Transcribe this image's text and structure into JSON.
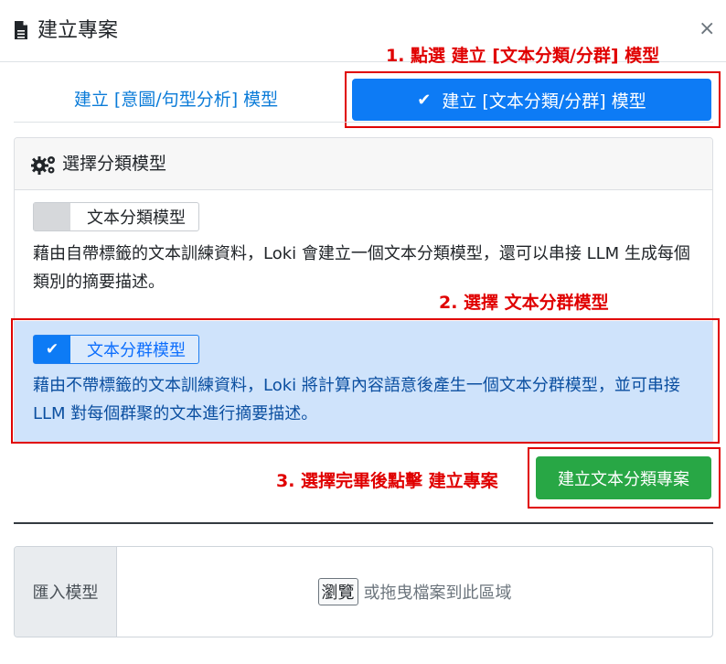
{
  "modal": {
    "title": "建立專案",
    "close": "×"
  },
  "tabs": {
    "intent": "建立 [意圖/句型分析] 模型",
    "text": "建立 [文本分類/分群] 模型",
    "check": "✔"
  },
  "annotations": {
    "step1": "1. 點選 建立 [文本分類/分群] 模型",
    "step2": "2. 選擇 文本分群模型",
    "step3": "3. 選擇完畢後點擊 建立專案"
  },
  "model_select": {
    "header": "選擇分類模型",
    "classification": {
      "label": "文本分類模型",
      "description": "藉由自帶標籤的文本訓練資料，Loki 會建立一個文本分類模型，還可以串接 LLM 生成每個類別的摘要描述。",
      "selected": false
    },
    "clustering": {
      "label": "文本分群模型",
      "description": "藉由不帶標籤的文本訓練資料，Loki 將計算內容語意後產生一個文本分群模型，並可串接 LLM 對每個群聚的文本進行摘要描述。",
      "selected": true,
      "check": "✔"
    }
  },
  "create_button": "建立文本分類專案",
  "import": {
    "label": "匯入模型",
    "browse": "瀏覽",
    "hint": "或拖曳檔案到此區域"
  },
  "colors": {
    "primary": "#0d7bf5",
    "success": "#28a745",
    "annotation": "#e00000",
    "selected_bg": "#cfe3fb"
  }
}
